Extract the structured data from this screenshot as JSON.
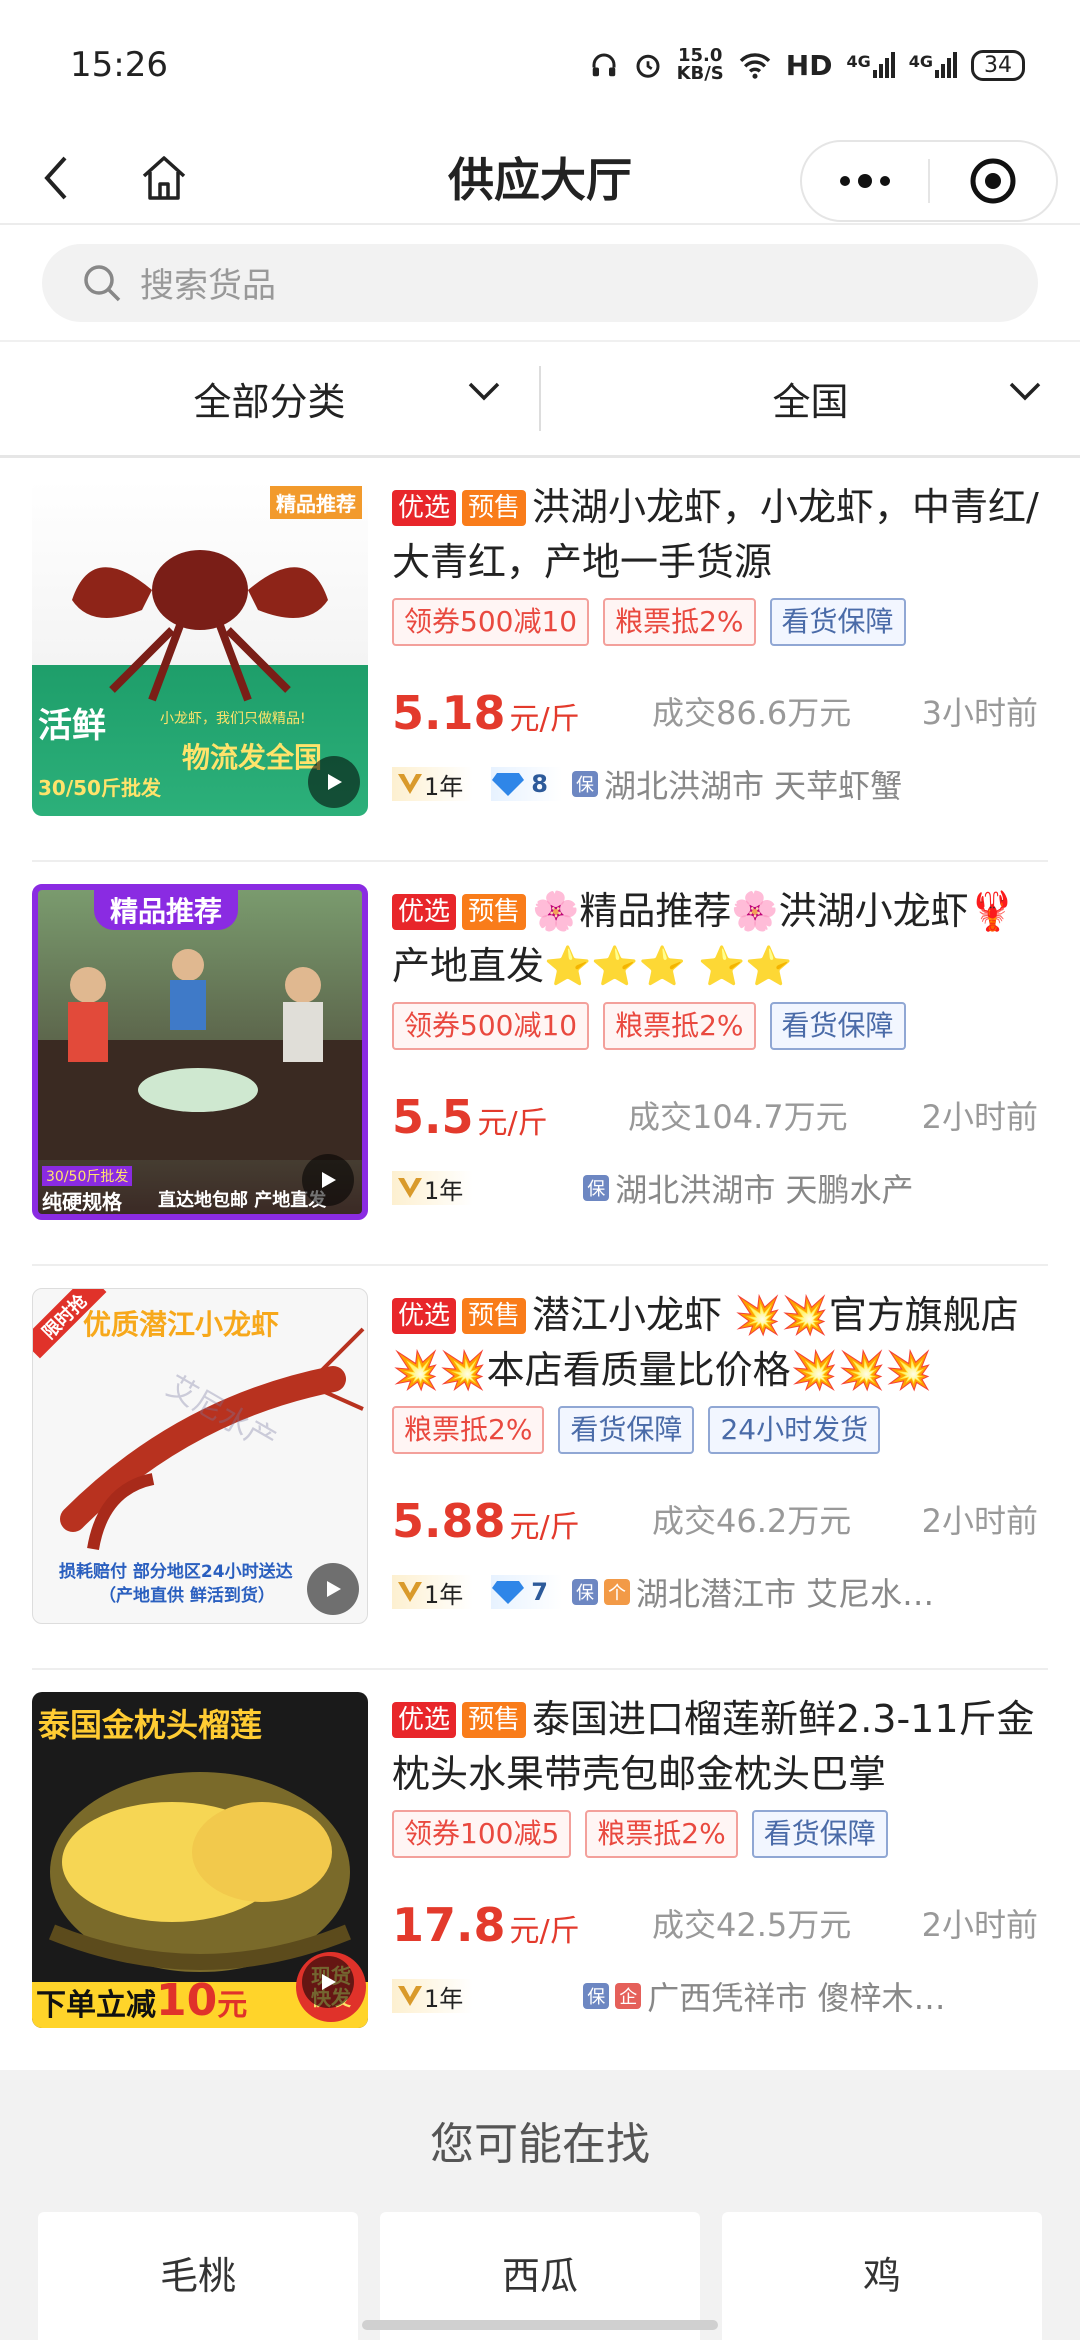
{
  "status_bar": {
    "time": "15:26",
    "speed_value": "15.0",
    "speed_unit": "KB/S",
    "network": "HD",
    "signal_1": "4G",
    "signal_2": "4G",
    "battery": "34"
  },
  "nav": {
    "title": "供应大厅",
    "icons": [
      "back-arrow-icon",
      "home-icon",
      "more-dots-icon",
      "close-target-icon"
    ]
  },
  "search": {
    "placeholder": "搜索货品"
  },
  "filters": {
    "category": "全部分类",
    "region": "全国"
  },
  "items": [
    {
      "tags": [
        "优选",
        "预售"
      ],
      "title": "洪湖小龙虾，小龙虾，中青红/大青红，产地一手货源",
      "chips": [
        "领券500减10",
        "粮票抵2%",
        "看货保障"
      ],
      "price": "5.18",
      "unit": "元/斤",
      "deal": "成交86.6万元",
      "time": "3小时前",
      "year": "1年",
      "diamond": "8",
      "location": "湖北洪湖市 天苹虾蟹",
      "thumb": {
        "top_label": "精品推荐",
        "badge": "活鲜",
        "slogan": "小龙虾，我们只做精品!",
        "banner": "物流发全国",
        "sub": "30/50斤批发"
      }
    },
    {
      "tags": [
        "优选",
        "预售"
      ],
      "title": "🌸精品推荐🌸洪湖小龙虾🦞产地直发⭐⭐⭐ ⭐⭐",
      "chips": [
        "领券500减10",
        "粮票抵2%",
        "看货保障"
      ],
      "price": "5.5",
      "unit": "元/斤",
      "deal": "成交104.7万元",
      "time": "2小时前",
      "year": "1年",
      "diamond": "",
      "location": "湖北洪湖市 天鹏水产",
      "thumb": {
        "top_label": "精品推荐",
        "badge": "30/50斤批发",
        "sub": "纯硬规格",
        "banner": "直达地包邮 产地直发"
      }
    },
    {
      "tags": [
        "优选",
        "预售"
      ],
      "title": "潜江小龙虾 💥💥官方旗舰店💥💥本店看质量比价格💥💥💥",
      "chips": [
        "粮票抵2%",
        "看货保障",
        "24小时发货"
      ],
      "price": "5.88",
      "unit": "元/斤",
      "deal": "成交46.2万元",
      "time": "2小时前",
      "year": "1年",
      "diamond": "7",
      "location": "湖北潜江市 艾尼水…",
      "thumb": {
        "corner": "限时抢",
        "top_label": "优质潜江小龙虾",
        "watermark": "艾尼水产",
        "banner": "损耗赔付 部分地区24小时送达",
        "sub": "（产地直供 鲜活到货）"
      }
    },
    {
      "tags": [
        "优选",
        "预售"
      ],
      "title": "泰国进口榴莲新鲜2.3-11斤金枕头水果带壳包邮金枕头巴掌",
      "chips": [
        "领券100减5",
        "粮票抵2%",
        "看货保障"
      ],
      "price": "17.8",
      "unit": "元/斤",
      "deal": "成交42.5万元",
      "time": "2小时前",
      "year": "1年",
      "diamond": "",
      "location": "广西凭祥市 傻梓木…",
      "thumb": {
        "top_label": "泰国金枕头榴莲",
        "banner": "下单立减",
        "banner_num": "10",
        "banner_unit": "元",
        "corner": "现货快发"
      }
    }
  ],
  "suggest": {
    "title": "您可能在找",
    "items": [
      "毛桃",
      "西瓜",
      "鸡"
    ]
  },
  "colors": {
    "price_red": "#e33a2c",
    "tag_red": "#e8262a",
    "tag_orange": "#f97c1a",
    "chip_blue": "#4a6ba8"
  }
}
